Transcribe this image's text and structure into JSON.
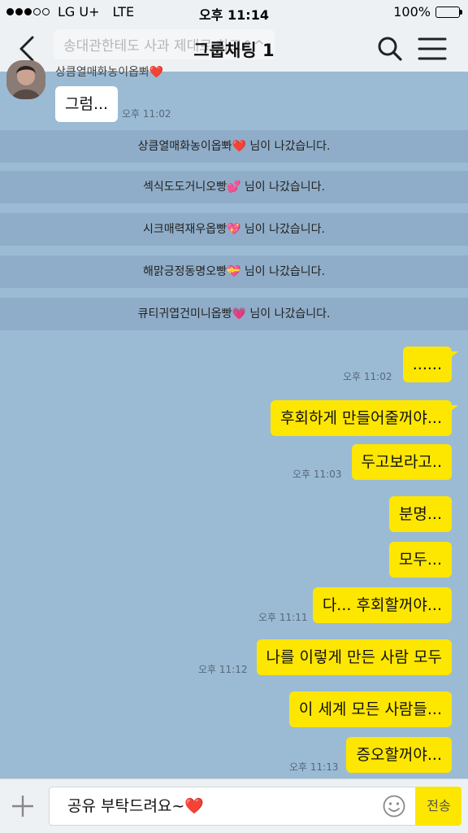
{
  "status": {
    "carrier": "LG U+",
    "network": "LTE",
    "time": "오후 11:14",
    "battery": "100%",
    "battery_level": 1.0
  },
  "header": {
    "title": "그룹채팅 1",
    "ghost_notice": "송대관한테도 사과 제대로 하고^^"
  },
  "incoming": {
    "sender": "상큼열매화농이옵뽜❤️",
    "message": "그럼...",
    "time": "오후 11:02"
  },
  "notices": [
    "상큼열매화농이옵뽜❤️ 님이 나갔습니다.",
    "섹식도도거니오빵💕 님이 나갔습니다.",
    "시크매력재우옵빵💖 님이 나갔습니다.",
    "해맑긍정동명오빵💝 님이 나갔습니다.",
    "큐티귀엽건미니옵빵💗 님이 나갔습니다."
  ],
  "outgoing": [
    {
      "text": "......",
      "time": "오후 11:02"
    },
    {
      "text": "후회하게 만들어줄꺼야...",
      "time": ""
    },
    {
      "text": "두고보라고..",
      "time": "오후 11:03"
    },
    {
      "text": "분명...",
      "time": ""
    },
    {
      "text": "모두...",
      "time": ""
    },
    {
      "text": "다... 후회할꺼야...",
      "time": "오후 11:11"
    },
    {
      "text": "나를 이렇게 만든 사람 모두",
      "time": "오후 11:12"
    },
    {
      "text": "이 세계 모든 사람들...",
      "time": ""
    },
    {
      "text": "증오할꺼야...",
      "time": "오후 11:13"
    }
  ],
  "input": {
    "value": "공유 부탁드려요~❤️",
    "send_label": "전송"
  },
  "icons": {
    "back": "chevron-left-icon",
    "search": "search-icon",
    "menu": "hamburger-menu-icon",
    "plus": "plus-icon",
    "emoji": "smiley-icon"
  },
  "colors": {
    "chat_background": "#9bbbd4",
    "my_bubble": "#fde600",
    "their_bubble": "#ffffff",
    "battery": "#2fbf3a"
  }
}
